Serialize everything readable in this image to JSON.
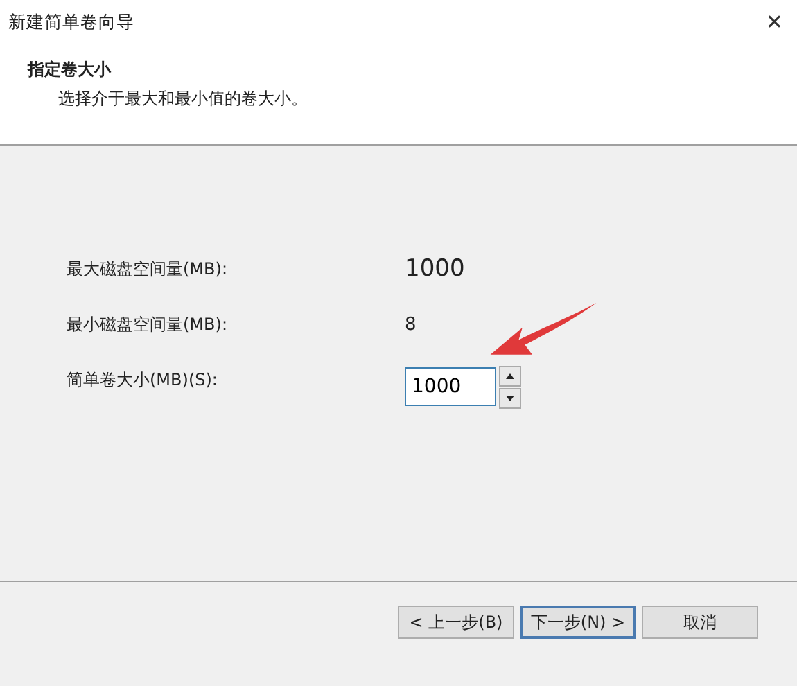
{
  "window": {
    "title": "新建简单卷向导",
    "close": "✕"
  },
  "header": {
    "title": "指定卷大小",
    "subtitle": "选择介于最大和最小值的卷大小。"
  },
  "rows": [
    {
      "kind": "value",
      "label": "最大磁盘空间量(MB):",
      "value": "1000",
      "large": true
    },
    {
      "kind": "value",
      "label": "最小磁盘空间量(MB):",
      "value": "8",
      "large": false
    },
    {
      "kind": "spin",
      "label": "简单卷大小(MB)(S):",
      "value": "1000"
    }
  ],
  "buttons": [
    {
      "label": "< 上一步(B)",
      "default": false
    },
    {
      "label": "下一步(N) >",
      "default": true
    },
    {
      "label": "取消",
      "default": false
    }
  ]
}
